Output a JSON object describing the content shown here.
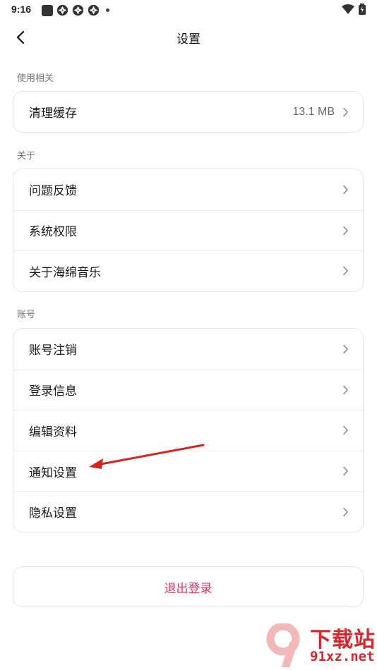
{
  "status_bar": {
    "time": "9:16"
  },
  "header": {
    "title": "设置"
  },
  "sections": {
    "usage": {
      "label": "使用相关",
      "items": [
        {
          "label": "清理缓存",
          "value": "13.1 MB"
        }
      ]
    },
    "about": {
      "label": "关于",
      "items": [
        {
          "label": "问题反馈"
        },
        {
          "label": "系统权限"
        },
        {
          "label": "关于海绵音乐"
        }
      ]
    },
    "account": {
      "label": "账号",
      "items": [
        {
          "label": "账号注销"
        },
        {
          "label": "登录信息"
        },
        {
          "label": "编辑资料"
        },
        {
          "label": "通知设置"
        },
        {
          "label": "隐私设置"
        }
      ]
    }
  },
  "logout": {
    "label": "退出登录"
  },
  "watermark": {
    "top": "下载站",
    "bottom": "91xz.net"
  },
  "colors": {
    "accent": "#e8305a",
    "annotation_arrow": "#d9231f",
    "watermark": "#d8262b"
  },
  "icons": {
    "back": "chevron-left-icon",
    "row": "chevron-right-icon"
  }
}
